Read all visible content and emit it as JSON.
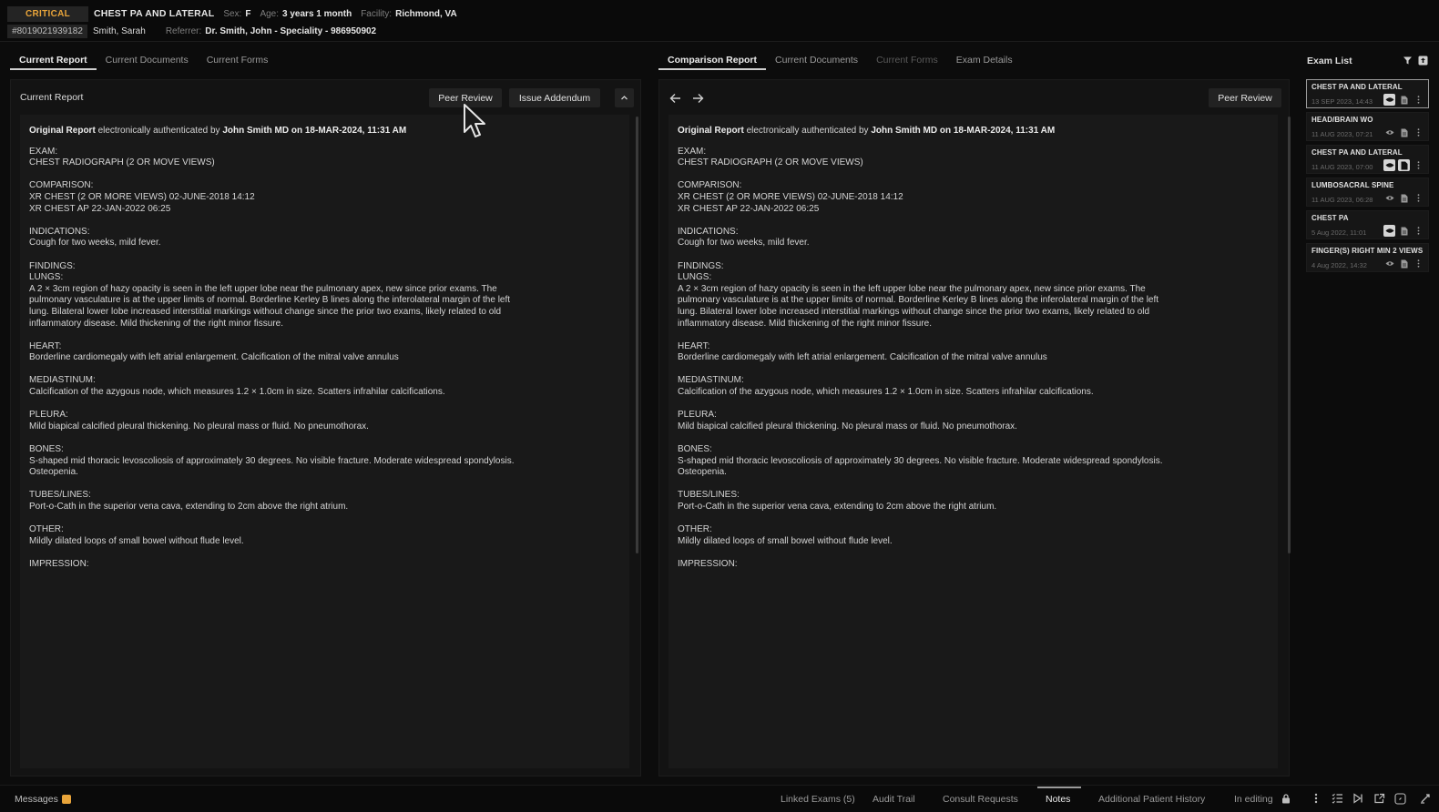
{
  "header": {
    "status": "CRITICAL",
    "exam_title": "CHEST PA AND LATERAL",
    "sex_label": "Sex:",
    "sex_value": "F",
    "age_label": "Age:",
    "age_value": "3 years 1 month",
    "facility_label": "Facility:",
    "facility_value": "Richmond, VA",
    "mrn": "#8019021939182",
    "patient_name": "Smith, Sarah",
    "referrer_label": "Referrer:",
    "referrer_value": "Dr. Smith, John - Speciality - 986950902"
  },
  "left_tabs": [
    "Current Report",
    "Current Documents",
    "Current Forms"
  ],
  "right_tabs": [
    "Comparison Report",
    "Current Documents",
    "Current Forms",
    "Exam Details"
  ],
  "left_panel": {
    "title": "Current Report",
    "peer_review": "Peer Review",
    "issue_addendum": "Issue Addendum"
  },
  "right_panel": {
    "peer_review": "Peer Review"
  },
  "report": {
    "auth_prefix": "Original Report",
    "auth_middle": " electronically authenticated by ",
    "auth_by": "John Smith MD on 18-MAR-2024, 11:31 AM",
    "sections": [
      {
        "heading": "EXAM:",
        "lines": [
          "CHEST RADIOGRAPH (2 OR MOVE VIEWS)"
        ]
      },
      {
        "heading": "COMPARISON:",
        "lines": [
          "XR CHEST (2 OR MORE VIEWS)  02-JUNE-2018 14:12",
          "XR CHEST AP 22-JAN-2022 06:25"
        ]
      },
      {
        "heading": "INDICATIONS:",
        "lines": [
          "Cough for two weeks, mild fever."
        ]
      },
      {
        "heading": "FINDINGS:",
        "lines": [
          "LUNGS:",
          "A 2 × 3cm region of hazy opacity is seen in the left upper lobe near the pulmonary apex, new since prior exams.  The",
          "pulmonary vasculature is at the upper limits of normal. Borderline Kerley B lines along the inferolateral margin of the left",
          "lung. Bilateral lower lobe increased interstitial markings without change since the prior two exams, likely related to old",
          "inflammatory disease. Mild thickening of the right minor fissure."
        ]
      },
      {
        "heading": "HEART:",
        "lines": [
          "Borderline cardiomegaly with left atrial enlargement. Calcification of the mitral valve annulus"
        ]
      },
      {
        "heading": "MEDIASTINUM:",
        "lines": [
          "Calcification of the azygous node, which measures 1.2 × 1.0cm in size. Scatters infrahilar calcifications."
        ]
      },
      {
        "heading": "PLEURA:",
        "lines": [
          "Mild biapical calcified pleural thickening.  No pleural mass or fluid.  No pneumothorax."
        ]
      },
      {
        "heading": "BONES:",
        "lines": [
          "S-shaped mid thoracic levoscoliosis of approximately 30 degrees. No visible fracture. Moderate widespread spondylosis.",
          "Osteopenia."
        ]
      },
      {
        "heading": "TUBES/LINES:",
        "lines": [
          "Port-o-Cath in the superior vena cava, extending to 2cm above the right atrium."
        ]
      },
      {
        "heading": "OTHER:",
        "lines": [
          "Mildly dilated loops of small bowel without flude level."
        ]
      },
      {
        "heading": "IMPRESSION:",
        "lines": []
      }
    ]
  },
  "exam_list": {
    "title": "Exam List",
    "items": [
      {
        "name": "CHEST PA AND LATERAL",
        "date": "13 SEP 2023, 14:43",
        "selected": true,
        "eye_filled": true,
        "doc_filled": false
      },
      {
        "name": "HEAD/BRAIN WO",
        "date": "11 AUG 2023, 07:21",
        "selected": false,
        "eye_filled": false,
        "doc_filled": false
      },
      {
        "name": "CHEST PA AND LATERAL",
        "date": "11 AUG 2023, 07:00",
        "selected": false,
        "eye_filled": true,
        "doc_filled": true
      },
      {
        "name": "LUMBOSACRAL SPINE",
        "date": "11 AUG 2023, 06:28",
        "selected": false,
        "eye_filled": false,
        "doc_filled": false
      },
      {
        "name": "CHEST PA",
        "date": "5 Aug 2022, 11:01",
        "selected": false,
        "eye_filled": true,
        "doc_filled": false
      },
      {
        "name": "FINGER(S) RIGHT MIN 2 VIEWS",
        "date": "4 Aug 2022, 14:32",
        "selected": false,
        "eye_filled": false,
        "doc_filled": false
      }
    ]
  },
  "footer": {
    "messages": "Messages",
    "tabs": [
      "Linked Exams (5)",
      "Audit Trail",
      "Consult Requests",
      "Notes",
      "Additional Patient History"
    ],
    "active_tab": "Notes",
    "in_editing": "In editing"
  },
  "colors": {
    "critical": "#e8a43a",
    "background": "#0c0c0c",
    "panel": "#131313",
    "report_bg": "#191919"
  },
  "icons": {
    "back": "arrow-left-icon",
    "forward": "arrow-right-icon",
    "collapse": "chevron-up-icon",
    "filter": "filter-icon",
    "upload": "upload-icon",
    "eye": "eye-icon",
    "document": "document-icon",
    "more": "kebab-icon",
    "lock": "lock-icon"
  }
}
